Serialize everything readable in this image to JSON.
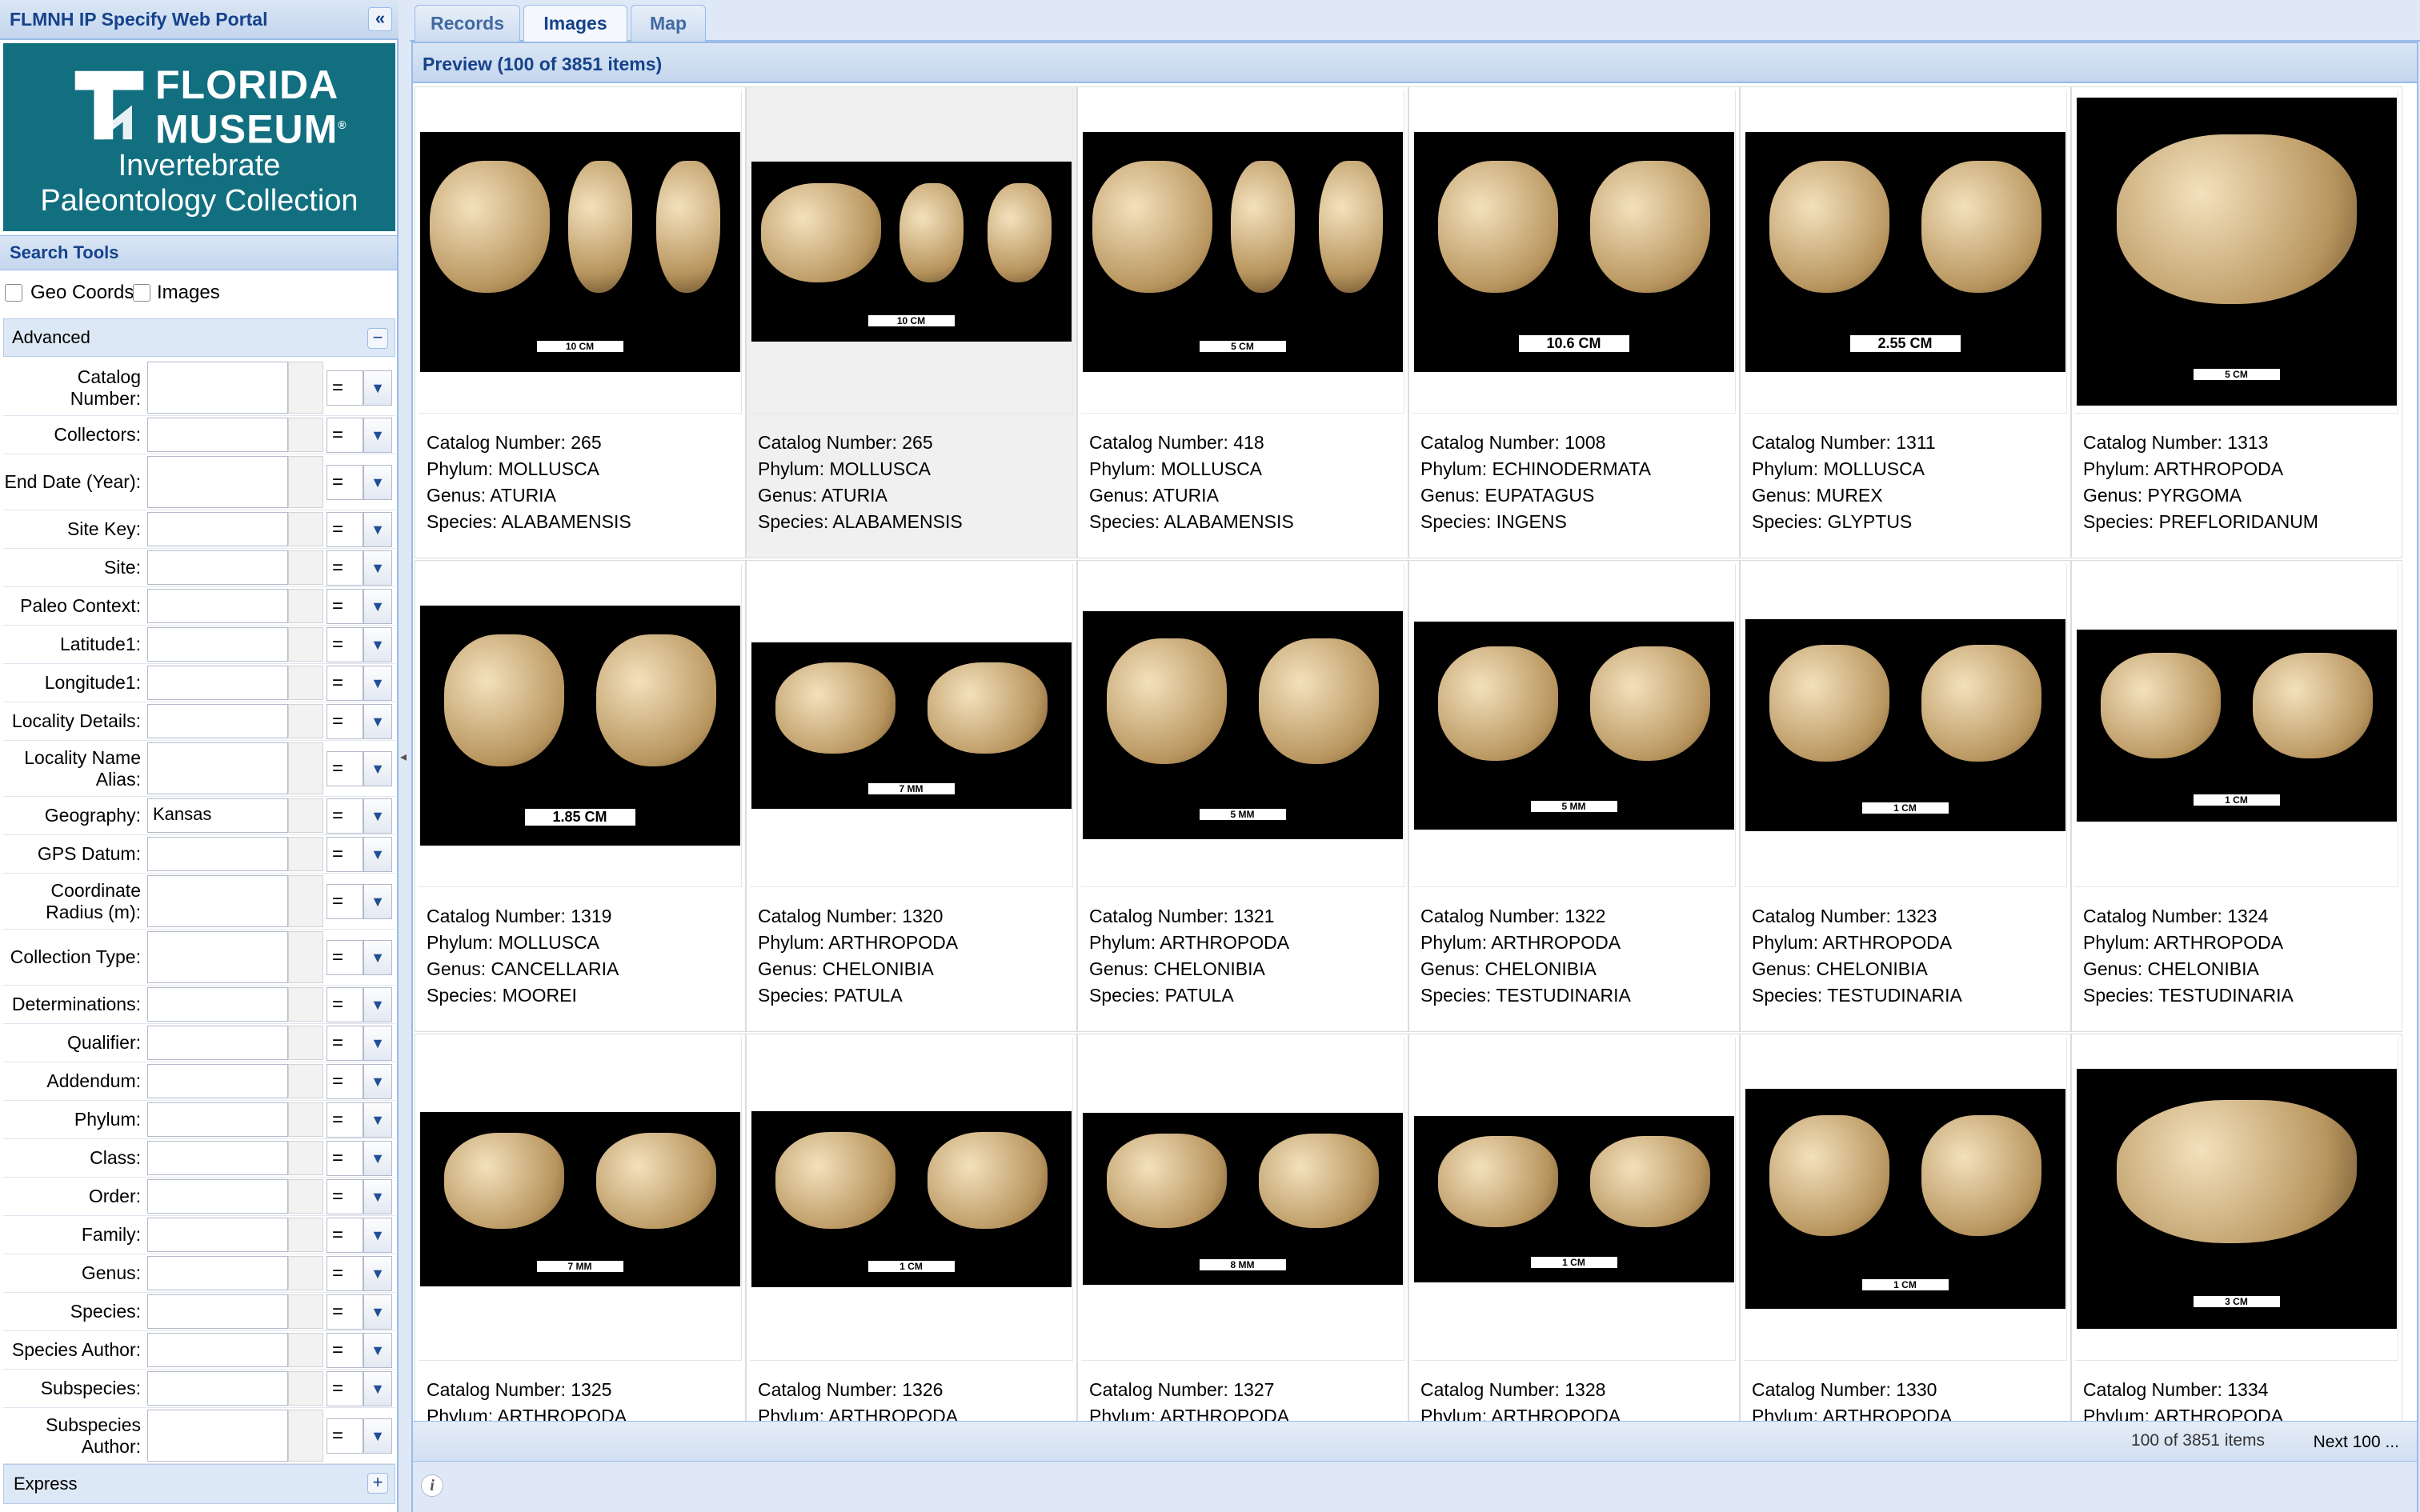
{
  "portal": {
    "title": "FLMNH IP Specify Web Portal",
    "collapse_icon": "double-chevron-left-icon"
  },
  "logo": {
    "line1": "FLORIDA",
    "line2": "MUSEUM",
    "reg": "®",
    "line3": "Invertebrate",
    "line4": "Paleontology Collection",
    "bg_color": "#126f80"
  },
  "search_tools": {
    "title": "Search Tools",
    "checkboxes": [
      {
        "label": "Geo Coords",
        "checked": false
      },
      {
        "label": "Images",
        "checked": false
      }
    ],
    "advanced_label": "Advanced",
    "advanced_toggle": "−",
    "express_label": "Express",
    "express_toggle": "+"
  },
  "fields": [
    {
      "label": "Catalog Number:",
      "value": "",
      "op": "="
    },
    {
      "label": "Collectors:",
      "value": "",
      "op": "="
    },
    {
      "label": "End Date (Year):",
      "value": "",
      "op": "="
    },
    {
      "label": "Site Key:",
      "value": "",
      "op": "="
    },
    {
      "label": "Site:",
      "value": "",
      "op": "="
    },
    {
      "label": "Paleo Context:",
      "value": "",
      "op": "="
    },
    {
      "label": "Latitude1:",
      "value": "",
      "op": "="
    },
    {
      "label": "Longitude1:",
      "value": "",
      "op": "="
    },
    {
      "label": "Locality Details:",
      "value": "",
      "op": "="
    },
    {
      "label": "Locality Name Alias:",
      "value": "",
      "op": "="
    },
    {
      "label": "Geography:",
      "value": "Kansas",
      "op": "="
    },
    {
      "label": "GPS Datum:",
      "value": "",
      "op": "="
    },
    {
      "label": "Coordinate Radius (m):",
      "value": "",
      "op": "="
    },
    {
      "label": "Collection Type:",
      "value": "",
      "op": "="
    },
    {
      "label": "Determinations:",
      "value": "",
      "op": "="
    },
    {
      "label": "Qualifier:",
      "value": "",
      "op": "="
    },
    {
      "label": "Addendum:",
      "value": "",
      "op": "="
    },
    {
      "label": "Phylum:",
      "value": "",
      "op": "="
    },
    {
      "label": "Class:",
      "value": "",
      "op": "="
    },
    {
      "label": "Order:",
      "value": "",
      "op": "="
    },
    {
      "label": "Family:",
      "value": "",
      "op": "="
    },
    {
      "label": "Genus:",
      "value": "",
      "op": "="
    },
    {
      "label": "Species:",
      "value": "",
      "op": "="
    },
    {
      "label": "Species Author:",
      "value": "",
      "op": "="
    },
    {
      "label": "Subspecies:",
      "value": "",
      "op": "="
    },
    {
      "label": "Subspecies Author:",
      "value": "",
      "op": "="
    }
  ],
  "tabs": [
    {
      "label": "Records",
      "active": false
    },
    {
      "label": "Images",
      "active": true
    },
    {
      "label": "Map",
      "active": false
    }
  ],
  "preview": {
    "title": "Preview (100 of 3851 items)"
  },
  "labels": {
    "catalog": "Catalog Number: ",
    "phylum": "Phylum: ",
    "genus": "Genus: ",
    "species": "Species: "
  },
  "cards": [
    {
      "catalog": "265",
      "phylum": "MOLLUSCA",
      "genus": "ATURIA",
      "species": "ALABAMENSIS",
      "scale": "10 CM",
      "selected": false
    },
    {
      "catalog": "265",
      "phylum": "MOLLUSCA",
      "genus": "ATURIA",
      "species": "ALABAMENSIS",
      "scale": "10 CM",
      "selected": true
    },
    {
      "catalog": "418",
      "phylum": "MOLLUSCA",
      "genus": "ATURIA",
      "species": "ALABAMENSIS",
      "scale": "5 CM",
      "selected": false
    },
    {
      "catalog": "1008",
      "phylum": "ECHINODERMATA",
      "genus": "EUPATAGUS",
      "species": "INGENS",
      "scale": "10.6 CM",
      "selected": false
    },
    {
      "catalog": "1311",
      "phylum": "MOLLUSCA",
      "genus": "MUREX",
      "species": "GLYPTUS",
      "scale": "2.55 CM",
      "selected": false
    },
    {
      "catalog": "1313",
      "phylum": "ARTHROPODA",
      "genus": "PYRGOMA",
      "species": "PREFLORIDANUM",
      "scale": "5 CM",
      "selected": false
    },
    {
      "catalog": "1319",
      "phylum": "MOLLUSCA",
      "genus": "CANCELLARIA",
      "species": "MOOREI",
      "scale": "1.85 CM",
      "selected": false
    },
    {
      "catalog": "1320",
      "phylum": "ARTHROPODA",
      "genus": "CHELONIBIA",
      "species": "PATULA",
      "scale": "7 MM",
      "selected": false
    },
    {
      "catalog": "1321",
      "phylum": "ARTHROPODA",
      "genus": "CHELONIBIA",
      "species": "PATULA",
      "scale": "5 MM",
      "selected": false
    },
    {
      "catalog": "1322",
      "phylum": "ARTHROPODA",
      "genus": "CHELONIBIA",
      "species": "TESTUDINARIA",
      "scale": "5 MM",
      "selected": false
    },
    {
      "catalog": "1323",
      "phylum": "ARTHROPODA",
      "genus": "CHELONIBIA",
      "species": "TESTUDINARIA",
      "scale": "1 CM",
      "selected": false
    },
    {
      "catalog": "1324",
      "phylum": "ARTHROPODA",
      "genus": "CHELONIBIA",
      "species": "TESTUDINARIA",
      "scale": "1 CM",
      "selected": false
    },
    {
      "catalog": "1325",
      "phylum": "ARTHROPODA",
      "genus": "",
      "species": "",
      "scale": "7 MM",
      "selected": false
    },
    {
      "catalog": "1326",
      "phylum": "ARTHROPODA",
      "genus": "",
      "species": "",
      "scale": "1 CM",
      "selected": false
    },
    {
      "catalog": "1327",
      "phylum": "ARTHROPODA",
      "genus": "",
      "species": "",
      "scale": "8 MM",
      "selected": false
    },
    {
      "catalog": "1328",
      "phylum": "ARTHROPODA",
      "genus": "",
      "species": "",
      "scale": "1 CM",
      "selected": false
    },
    {
      "catalog": "1330",
      "phylum": "ARTHROPODA",
      "genus": "",
      "species": "",
      "scale": "1 CM",
      "selected": false
    },
    {
      "catalog": "1334",
      "phylum": "ARTHROPODA",
      "genus": "",
      "species": "",
      "scale": "3 CM",
      "selected": false
    }
  ],
  "status": {
    "count": "100 of 3851 items",
    "next": "Next 100 ..."
  },
  "info_icon": "info-icon"
}
